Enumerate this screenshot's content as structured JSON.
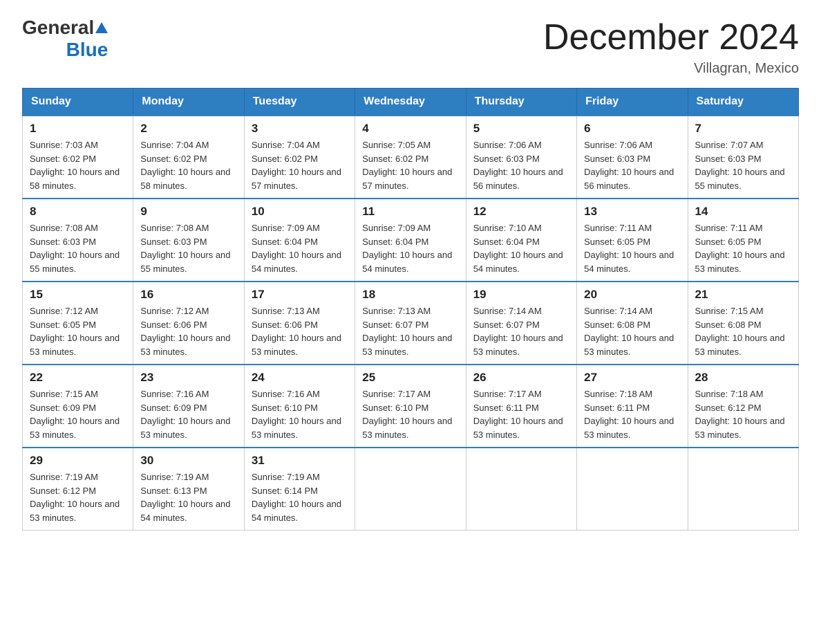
{
  "header": {
    "logo_general": "General",
    "logo_blue": "Blue",
    "month_title": "December 2024",
    "location": "Villagran, Mexico"
  },
  "days_of_week": [
    "Sunday",
    "Monday",
    "Tuesday",
    "Wednesday",
    "Thursday",
    "Friday",
    "Saturday"
  ],
  "weeks": [
    [
      {
        "day": "1",
        "sunrise": "7:03 AM",
        "sunset": "6:02 PM",
        "daylight": "10 hours and 58 minutes."
      },
      {
        "day": "2",
        "sunrise": "7:04 AM",
        "sunset": "6:02 PM",
        "daylight": "10 hours and 58 minutes."
      },
      {
        "day": "3",
        "sunrise": "7:04 AM",
        "sunset": "6:02 PM",
        "daylight": "10 hours and 57 minutes."
      },
      {
        "day": "4",
        "sunrise": "7:05 AM",
        "sunset": "6:02 PM",
        "daylight": "10 hours and 57 minutes."
      },
      {
        "day": "5",
        "sunrise": "7:06 AM",
        "sunset": "6:03 PM",
        "daylight": "10 hours and 56 minutes."
      },
      {
        "day": "6",
        "sunrise": "7:06 AM",
        "sunset": "6:03 PM",
        "daylight": "10 hours and 56 minutes."
      },
      {
        "day": "7",
        "sunrise": "7:07 AM",
        "sunset": "6:03 PM",
        "daylight": "10 hours and 55 minutes."
      }
    ],
    [
      {
        "day": "8",
        "sunrise": "7:08 AM",
        "sunset": "6:03 PM",
        "daylight": "10 hours and 55 minutes."
      },
      {
        "day": "9",
        "sunrise": "7:08 AM",
        "sunset": "6:03 PM",
        "daylight": "10 hours and 55 minutes."
      },
      {
        "day": "10",
        "sunrise": "7:09 AM",
        "sunset": "6:04 PM",
        "daylight": "10 hours and 54 minutes."
      },
      {
        "day": "11",
        "sunrise": "7:09 AM",
        "sunset": "6:04 PM",
        "daylight": "10 hours and 54 minutes."
      },
      {
        "day": "12",
        "sunrise": "7:10 AM",
        "sunset": "6:04 PM",
        "daylight": "10 hours and 54 minutes."
      },
      {
        "day": "13",
        "sunrise": "7:11 AM",
        "sunset": "6:05 PM",
        "daylight": "10 hours and 54 minutes."
      },
      {
        "day": "14",
        "sunrise": "7:11 AM",
        "sunset": "6:05 PM",
        "daylight": "10 hours and 53 minutes."
      }
    ],
    [
      {
        "day": "15",
        "sunrise": "7:12 AM",
        "sunset": "6:05 PM",
        "daylight": "10 hours and 53 minutes."
      },
      {
        "day": "16",
        "sunrise": "7:12 AM",
        "sunset": "6:06 PM",
        "daylight": "10 hours and 53 minutes."
      },
      {
        "day": "17",
        "sunrise": "7:13 AM",
        "sunset": "6:06 PM",
        "daylight": "10 hours and 53 minutes."
      },
      {
        "day": "18",
        "sunrise": "7:13 AM",
        "sunset": "6:07 PM",
        "daylight": "10 hours and 53 minutes."
      },
      {
        "day": "19",
        "sunrise": "7:14 AM",
        "sunset": "6:07 PM",
        "daylight": "10 hours and 53 minutes."
      },
      {
        "day": "20",
        "sunrise": "7:14 AM",
        "sunset": "6:08 PM",
        "daylight": "10 hours and 53 minutes."
      },
      {
        "day": "21",
        "sunrise": "7:15 AM",
        "sunset": "6:08 PM",
        "daylight": "10 hours and 53 minutes."
      }
    ],
    [
      {
        "day": "22",
        "sunrise": "7:15 AM",
        "sunset": "6:09 PM",
        "daylight": "10 hours and 53 minutes."
      },
      {
        "day": "23",
        "sunrise": "7:16 AM",
        "sunset": "6:09 PM",
        "daylight": "10 hours and 53 minutes."
      },
      {
        "day": "24",
        "sunrise": "7:16 AM",
        "sunset": "6:10 PM",
        "daylight": "10 hours and 53 minutes."
      },
      {
        "day": "25",
        "sunrise": "7:17 AM",
        "sunset": "6:10 PM",
        "daylight": "10 hours and 53 minutes."
      },
      {
        "day": "26",
        "sunrise": "7:17 AM",
        "sunset": "6:11 PM",
        "daylight": "10 hours and 53 minutes."
      },
      {
        "day": "27",
        "sunrise": "7:18 AM",
        "sunset": "6:11 PM",
        "daylight": "10 hours and 53 minutes."
      },
      {
        "day": "28",
        "sunrise": "7:18 AM",
        "sunset": "6:12 PM",
        "daylight": "10 hours and 53 minutes."
      }
    ],
    [
      {
        "day": "29",
        "sunrise": "7:19 AM",
        "sunset": "6:12 PM",
        "daylight": "10 hours and 53 minutes."
      },
      {
        "day": "30",
        "sunrise": "7:19 AM",
        "sunset": "6:13 PM",
        "daylight": "10 hours and 54 minutes."
      },
      {
        "day": "31",
        "sunrise": "7:19 AM",
        "sunset": "6:14 PM",
        "daylight": "10 hours and 54 minutes."
      },
      null,
      null,
      null,
      null
    ]
  ]
}
